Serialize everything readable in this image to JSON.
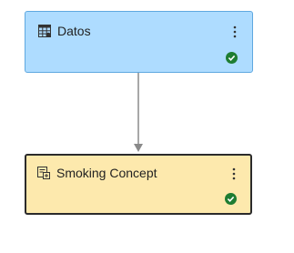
{
  "flow": {
    "nodes": [
      {
        "label": "Datos",
        "icon": "table-grid-icon",
        "status": "success-check-icon",
        "menu_icon": "more-vertical-icon"
      },
      {
        "label": "Smoking Concept",
        "icon": "model-document-icon",
        "status": "success-check-icon",
        "menu_icon": "more-vertical-icon"
      }
    ]
  },
  "colors": {
    "datos_fill": "#aedcff",
    "datos_border": "#5fa8e0",
    "smoking_fill": "#fde9ad",
    "selected_border": "#2b2b2b",
    "success": "#1e7d32",
    "connector": "#8a8a8a"
  }
}
